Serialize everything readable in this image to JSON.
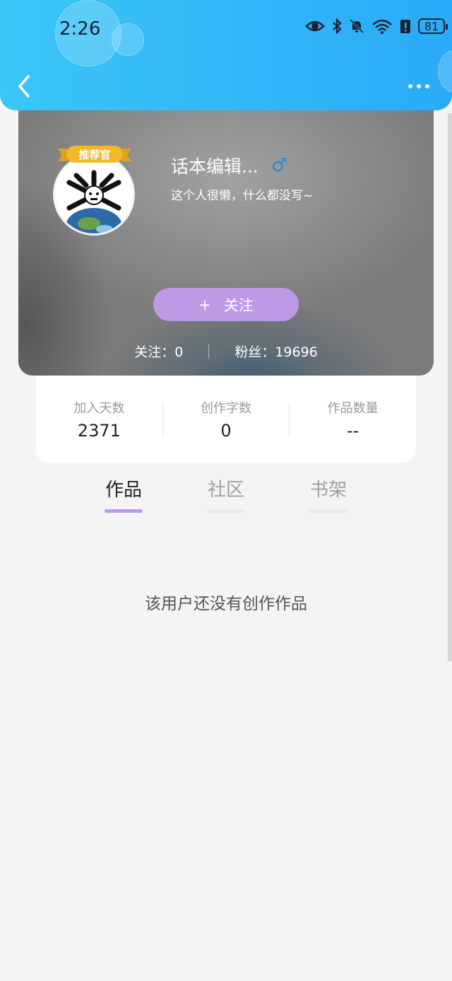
{
  "status_bar": {
    "time": "2:26",
    "battery": "81",
    "icons": [
      "eye-icon",
      "bluetooth-icon",
      "bell-off-icon",
      "wifi-icon",
      "battery-alert-icon",
      "battery-icon"
    ]
  },
  "header": {
    "back_icon": "chevron-left-icon",
    "more_icon": "more-dots-icon",
    "accent": "#2aaaf8"
  },
  "profile": {
    "badge": "推荐官",
    "name": "话本编辑...",
    "gender_symbol": "♂",
    "bio": "这个人很懒，什么都没写~",
    "follow_button": "关注",
    "follow_plus": "+",
    "following": "关注：0",
    "fans": "粉丝：19696",
    "accent": "#bd99e6"
  },
  "stats": [
    {
      "label": "加入天数",
      "value": "2371"
    },
    {
      "label": "创作字数",
      "value": "0"
    },
    {
      "label": "作品数量",
      "value": "--"
    }
  ],
  "tabs": [
    {
      "label": "作品",
      "active": true
    },
    {
      "label": "社区",
      "active": false
    },
    {
      "label": "书架",
      "active": false
    }
  ],
  "empty_text": "该用户还没有创作作品"
}
